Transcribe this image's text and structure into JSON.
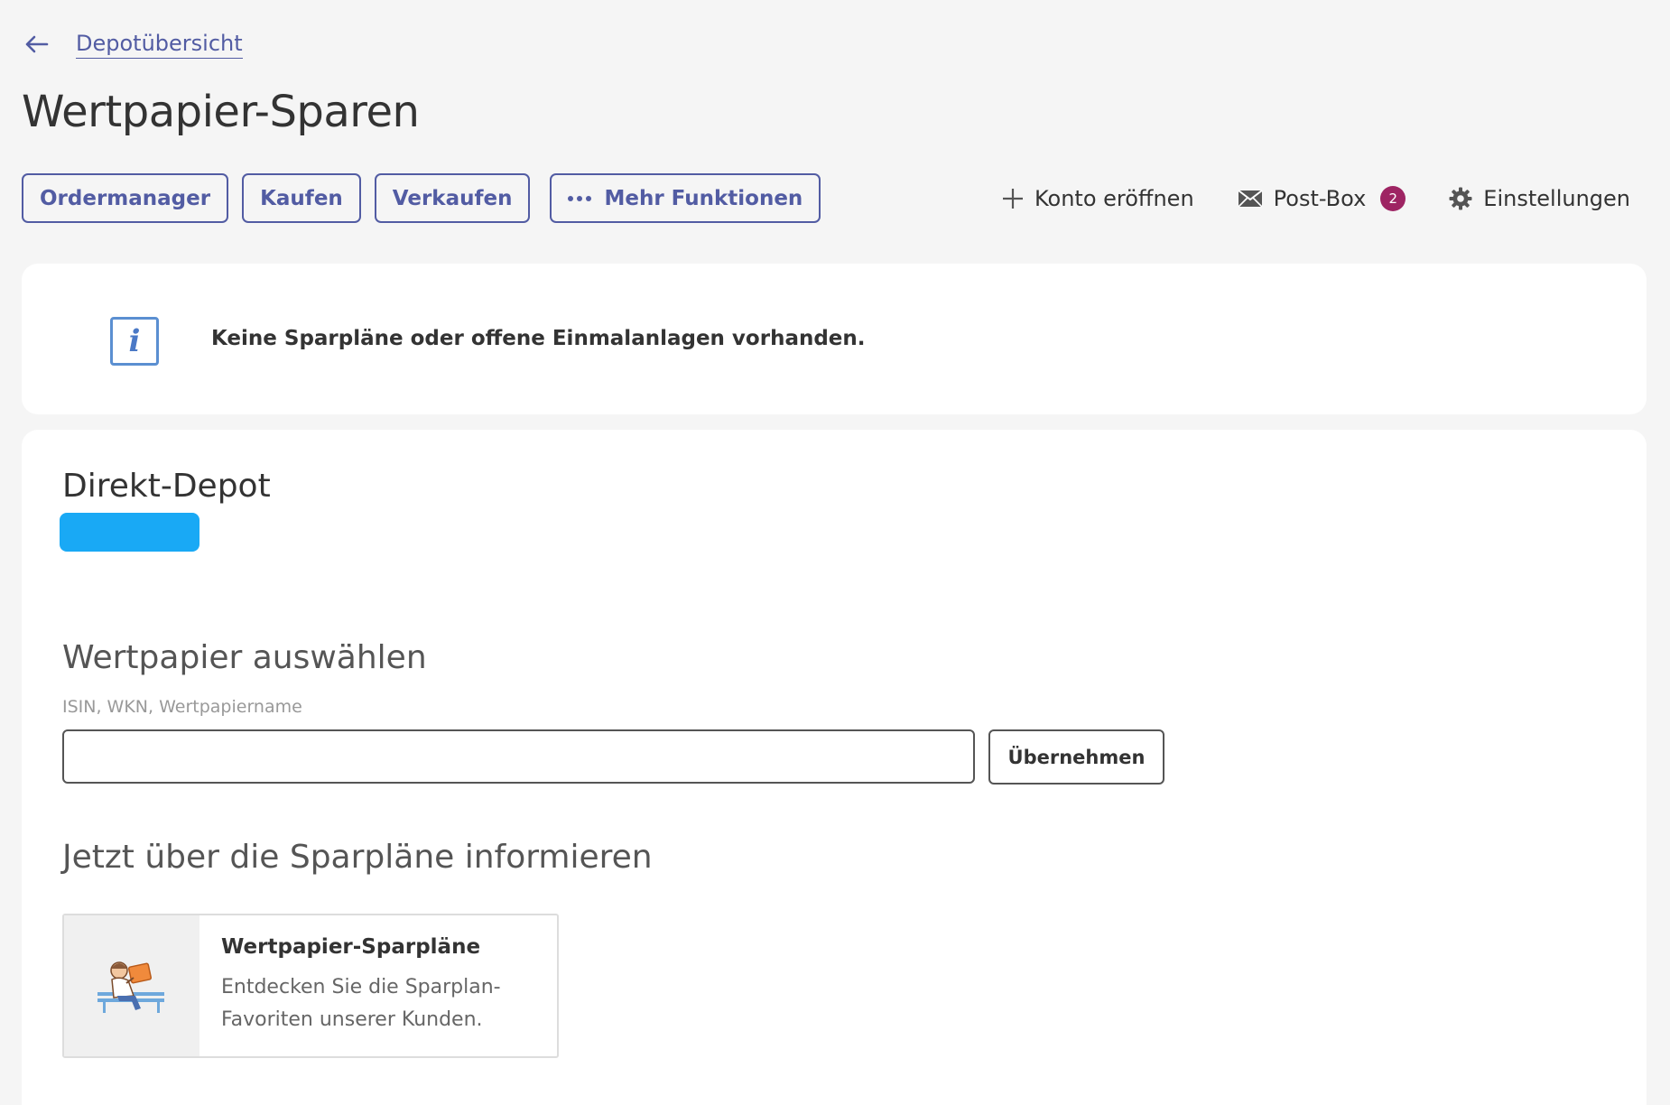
{
  "breadcrumb": {
    "back_label": "Depotübersicht"
  },
  "page": {
    "title": "Wertpapier-Sparen"
  },
  "actions": {
    "ordermanager": "Ordermanager",
    "kaufen": "Kaufen",
    "verkaufen": "Verkaufen",
    "mehr_funktionen": "Mehr Funktionen"
  },
  "top_nav": {
    "konto": {
      "label": "Konto eröffnen",
      "icon": "plus-icon"
    },
    "postbox": {
      "label": "Post-Box",
      "badge": "2",
      "icon": "envelope-icon"
    },
    "settings": {
      "label": "Einstellungen",
      "icon": "gear-icon"
    }
  },
  "info": {
    "icon": "info-icon",
    "icon_glyph": "i",
    "message": "Keine Sparpläne oder offene Einmalanlagen vorhanden."
  },
  "depot": {
    "title": "Direkt-Depot",
    "pill_color": "#19a9f5"
  },
  "security_select": {
    "heading": "Wertpapier auswählen",
    "field_label": "ISIN, WKN, Wertpapiername",
    "value": "",
    "apply_label": "Übernehmen"
  },
  "info_section": {
    "heading": "Jetzt über die Sparpläne informieren",
    "promo": {
      "title": "Wertpapier-Sparpläne",
      "text": "Entdecken Sie die Sparplan-Favoriten unserer Kunden."
    }
  },
  "colors": {
    "accent": "#525ca3",
    "badge": "#9e2463",
    "info_icon": "#5b8fd1",
    "background": "#f5f5f5"
  }
}
